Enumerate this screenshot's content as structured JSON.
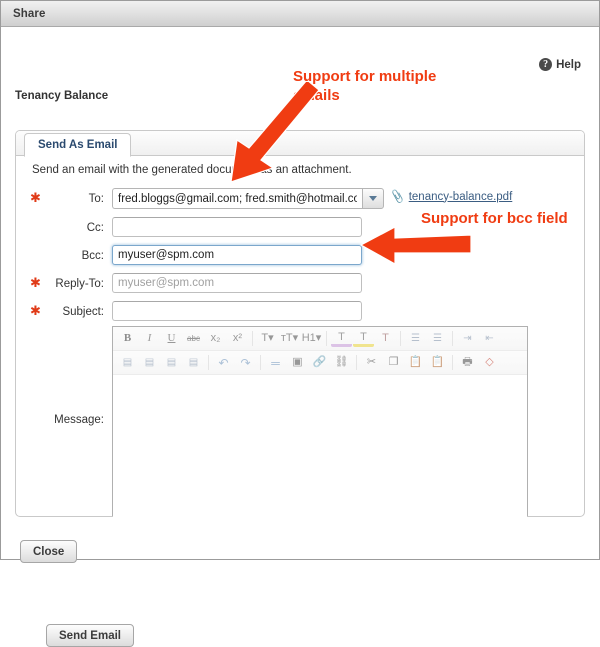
{
  "window": {
    "title": "Share"
  },
  "help": {
    "label": "Help",
    "icon": "question-circle-icon",
    "glyph": "?"
  },
  "document": {
    "title": "Tenancy Balance"
  },
  "panel": {
    "tabs": [
      {
        "label": "Send As Email",
        "selected": true
      }
    ],
    "intro": "Send an email with the generated document as an attachment.",
    "fields": [
      {
        "key": "to",
        "label": "To:",
        "required": true,
        "value": "fred.bloggs@gmail.com; fred.smith@hotmail.com",
        "placeholder": "",
        "has_dropdown": true,
        "focused": false
      },
      {
        "key": "cc",
        "label": "Cc:",
        "required": false,
        "value": "",
        "placeholder": "",
        "has_dropdown": false,
        "focused": false
      },
      {
        "key": "bcc",
        "label": "Bcc:",
        "required": false,
        "value": "myuser@spm.com",
        "placeholder": "",
        "has_dropdown": false,
        "focused": true
      },
      {
        "key": "reply_to",
        "label": "Reply-To:",
        "required": true,
        "value": "",
        "placeholder": "myuser@spm.com",
        "has_dropdown": false,
        "focused": false
      },
      {
        "key": "subject",
        "label": "Subject:",
        "required": true,
        "value": "",
        "placeholder": "",
        "has_dropdown": false,
        "focused": false
      }
    ],
    "attachment": {
      "icon": "paperclip-icon",
      "filename": "tenancy-balance.pdf"
    },
    "message": {
      "label": "Message:",
      "value": "",
      "toolbar_row_1": [
        {
          "name": "bold-icon",
          "glyph": "B",
          "style": "bold"
        },
        {
          "name": "italic-icon",
          "glyph": "I",
          "style": "italic"
        },
        {
          "name": "underline-icon",
          "glyph": "U",
          "style": "underline"
        },
        {
          "name": "strikethrough-icon",
          "glyph": "abc",
          "style": "strike"
        },
        {
          "name": "subscript-icon",
          "glyph": "x₂",
          "style": "plain"
        },
        {
          "name": "superscript-icon",
          "glyph": "x²",
          "style": "plain"
        },
        {
          "name": "separator",
          "glyph": "",
          "style": "sep"
        },
        {
          "name": "font-name-icon",
          "glyph": "T▾",
          "style": "plain"
        },
        {
          "name": "font-size-icon",
          "glyph": "тT▾",
          "style": "plain"
        },
        {
          "name": "heading-icon",
          "glyph": "H1▾",
          "style": "plain"
        },
        {
          "name": "separator",
          "glyph": "",
          "style": "sep"
        },
        {
          "name": "text-color-icon",
          "glyph": "T",
          "style": "color-a"
        },
        {
          "name": "highlight-color-icon",
          "glyph": "T",
          "style": "color-b"
        },
        {
          "name": "remove-format-icon",
          "glyph": "T",
          "style": "color-c"
        },
        {
          "name": "separator",
          "glyph": "",
          "style": "sep"
        },
        {
          "name": "bullet-list-icon",
          "glyph": "☰",
          "style": "list"
        },
        {
          "name": "numbered-list-icon",
          "glyph": "☰",
          "style": "list"
        },
        {
          "name": "separator",
          "glyph": "",
          "style": "sep"
        },
        {
          "name": "indent-icon",
          "glyph": "⇥",
          "style": "list"
        },
        {
          "name": "outdent-icon",
          "glyph": "⇤",
          "style": "list"
        }
      ],
      "toolbar_row_2": [
        {
          "name": "align-left-icon",
          "glyph": "▤",
          "style": "align"
        },
        {
          "name": "align-center-icon",
          "glyph": "▤",
          "style": "align"
        },
        {
          "name": "align-right-icon",
          "glyph": "▤",
          "style": "align"
        },
        {
          "name": "align-justify-icon",
          "glyph": "▤",
          "style": "align"
        },
        {
          "name": "separator",
          "glyph": "",
          "style": "sep"
        },
        {
          "name": "undo-icon",
          "glyph": "↶",
          "style": "blue"
        },
        {
          "name": "redo-icon",
          "glyph": "↷",
          "style": "blue"
        },
        {
          "name": "separator",
          "glyph": "",
          "style": "sep"
        },
        {
          "name": "horizontal-rule-icon",
          "glyph": "═",
          "style": "blue"
        },
        {
          "name": "insert-image-icon",
          "glyph": "▣",
          "style": "plain"
        },
        {
          "name": "insert-link-icon",
          "glyph": "🔗",
          "style": "plain"
        },
        {
          "name": "unlink-icon",
          "glyph": "⛓",
          "style": "plain"
        },
        {
          "name": "separator",
          "glyph": "",
          "style": "sep"
        },
        {
          "name": "cut-icon",
          "glyph": "✂",
          "style": "plain"
        },
        {
          "name": "copy-icon",
          "glyph": "❐",
          "style": "plain"
        },
        {
          "name": "paste-icon",
          "glyph": "📋",
          "style": "plain"
        },
        {
          "name": "paste-text-icon",
          "glyph": "📋",
          "style": "plain"
        },
        {
          "name": "separator",
          "glyph": "",
          "style": "sep"
        },
        {
          "name": "print-icon",
          "glyph": "🖶",
          "style": "plain"
        },
        {
          "name": "source-code-icon",
          "glyph": "◇",
          "style": "red"
        }
      ]
    },
    "send_button": "Send Email"
  },
  "footer": {
    "close_button": "Close"
  },
  "annotations": [
    {
      "id": "multiple-emails",
      "text": "Support for multiple\nemails",
      "color": "#F03C12"
    },
    {
      "id": "bcc-field",
      "text": "Support for bcc field",
      "color": "#F03C12"
    }
  ]
}
